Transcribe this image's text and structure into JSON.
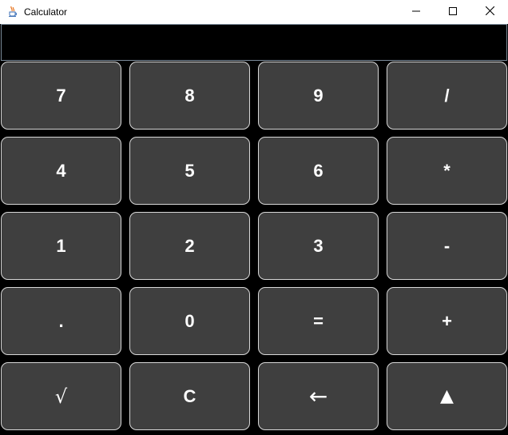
{
  "window": {
    "title": "Calculator",
    "icon": "java-cup-icon",
    "controls": {
      "minimize_icon": "minimize-icon",
      "maximize_icon": "maximize-icon",
      "close_icon": "close-icon"
    }
  },
  "display": {
    "value": ""
  },
  "keys": {
    "seven": "7",
    "eight": "8",
    "nine": "9",
    "divide": "/",
    "four": "4",
    "five": "5",
    "six": "6",
    "multiply": "*",
    "one": "1",
    "two": "2",
    "three": "3",
    "subtract": "-",
    "decimal": ".",
    "zero": "0",
    "equals": "=",
    "add": "+",
    "sqrt": "√",
    "clear": "C",
    "backspace": "←",
    "power": "▲"
  },
  "colors": {
    "background": "#000000",
    "key_background": "#3f3f3f",
    "key_border": "#d8d8d8",
    "key_text": "#ffffff",
    "titlebar": "#ffffff"
  }
}
